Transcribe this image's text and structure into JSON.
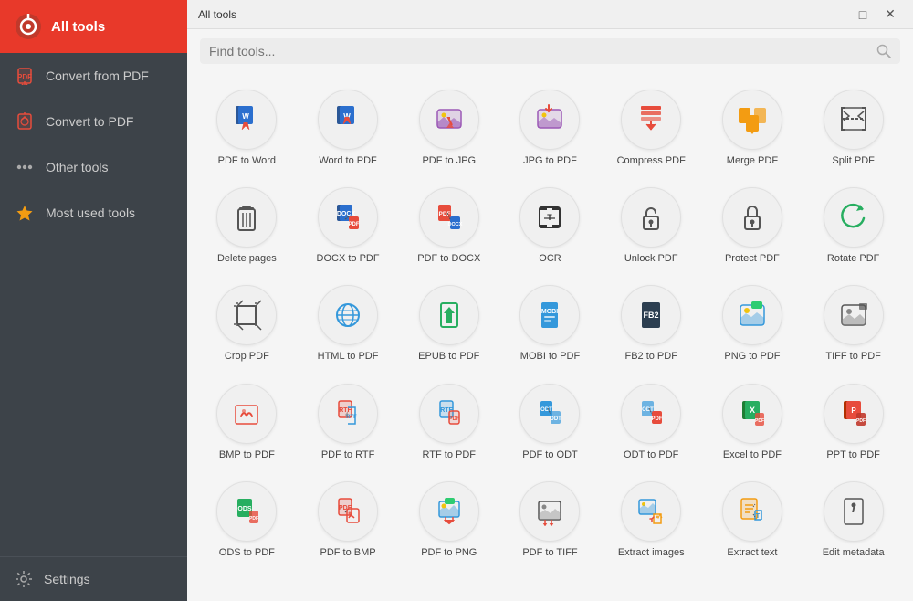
{
  "app": {
    "title": "All tools",
    "logo_text": "All tools"
  },
  "sidebar": {
    "items": [
      {
        "id": "all-tools",
        "label": "All tools",
        "active": true
      },
      {
        "id": "convert-from-pdf",
        "label": "Convert from PDF",
        "active": false
      },
      {
        "id": "convert-to-pdf",
        "label": "Convert to PDF",
        "active": false
      },
      {
        "id": "other-tools",
        "label": "Other tools",
        "active": false
      },
      {
        "id": "most-used-tools",
        "label": "Most used tools",
        "active": false
      }
    ],
    "settings_label": "Settings"
  },
  "search": {
    "placeholder": "Find tools..."
  },
  "titlebar": {
    "title": "All tools",
    "minimize": "—",
    "maximize": "□",
    "close": "✕"
  },
  "tools": [
    {
      "label": "PDF to Word"
    },
    {
      "label": "Word to PDF"
    },
    {
      "label": "PDF to JPG"
    },
    {
      "label": "JPG to PDF"
    },
    {
      "label": "Compress PDF"
    },
    {
      "label": "Merge PDF"
    },
    {
      "label": "Split PDF"
    },
    {
      "label": "Delete pages"
    },
    {
      "label": "DOCX to PDF"
    },
    {
      "label": "PDF to DOCX"
    },
    {
      "label": "OCR"
    },
    {
      "label": "Unlock PDF"
    },
    {
      "label": "Protect PDF"
    },
    {
      "label": "Rotate PDF"
    },
    {
      "label": "Crop PDF"
    },
    {
      "label": "HTML to PDF"
    },
    {
      "label": "EPUB to PDF"
    },
    {
      "label": "MOBI to PDF"
    },
    {
      "label": "FB2 to PDF"
    },
    {
      "label": "PNG to PDF"
    },
    {
      "label": "TIFF to PDF"
    },
    {
      "label": "BMP to PDF"
    },
    {
      "label": "PDF to RTF"
    },
    {
      "label": "RTF to PDF"
    },
    {
      "label": "PDF to ODT"
    },
    {
      "label": "ODT to PDF"
    },
    {
      "label": "Excel to PDF"
    },
    {
      "label": "PPT to PDF"
    },
    {
      "label": "ODS to PDF"
    },
    {
      "label": "PDF to BMP"
    },
    {
      "label": "PDF to PNG"
    },
    {
      "label": "PDF to TIFF"
    },
    {
      "label": "Extract images"
    },
    {
      "label": "Extract text"
    },
    {
      "label": "Edit metadata"
    }
  ]
}
